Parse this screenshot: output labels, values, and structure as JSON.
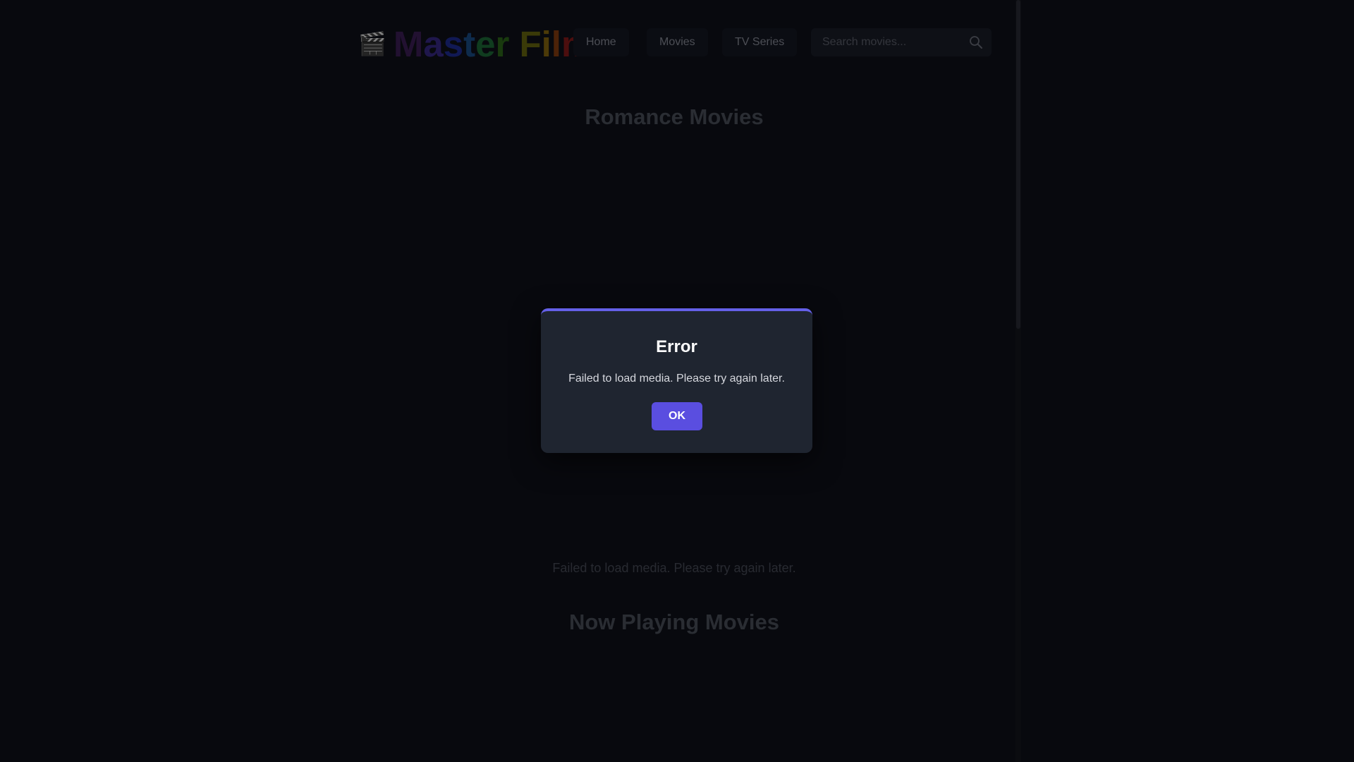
{
  "header": {
    "logo_icon": "🎬",
    "logo_letters": [
      "M",
      "a",
      "s",
      "t",
      "e",
      "r",
      " ",
      "F",
      "i",
      "l",
      "m"
    ],
    "logo_colors": [
      "#3f1f5a",
      "#3a2a8a",
      "#1f2f9a",
      "#1a4f8a",
      "#1e6e3a",
      "#2f6a1a",
      "#000000",
      "#6a6a10",
      "#8a6a10",
      "#8a3f10",
      "#8a1a1a"
    ],
    "nav": [
      {
        "label": "Home"
      },
      {
        "label": "Movies"
      },
      {
        "label": "TV Series"
      }
    ],
    "search": {
      "placeholder": "Search movies...",
      "value": ""
    },
    "icons": {
      "search": "search-icon",
      "logo": "clapper-board-icon"
    }
  },
  "sections": [
    {
      "title": "Romance Movies",
      "error": "Failed to load media. Please try again later."
    },
    {
      "title": "Now Playing Movies"
    }
  ],
  "modal": {
    "title": "Error",
    "message": "Failed to load media. Please try again later.",
    "button_label": "OK",
    "accent_color": "#6460e8"
  }
}
